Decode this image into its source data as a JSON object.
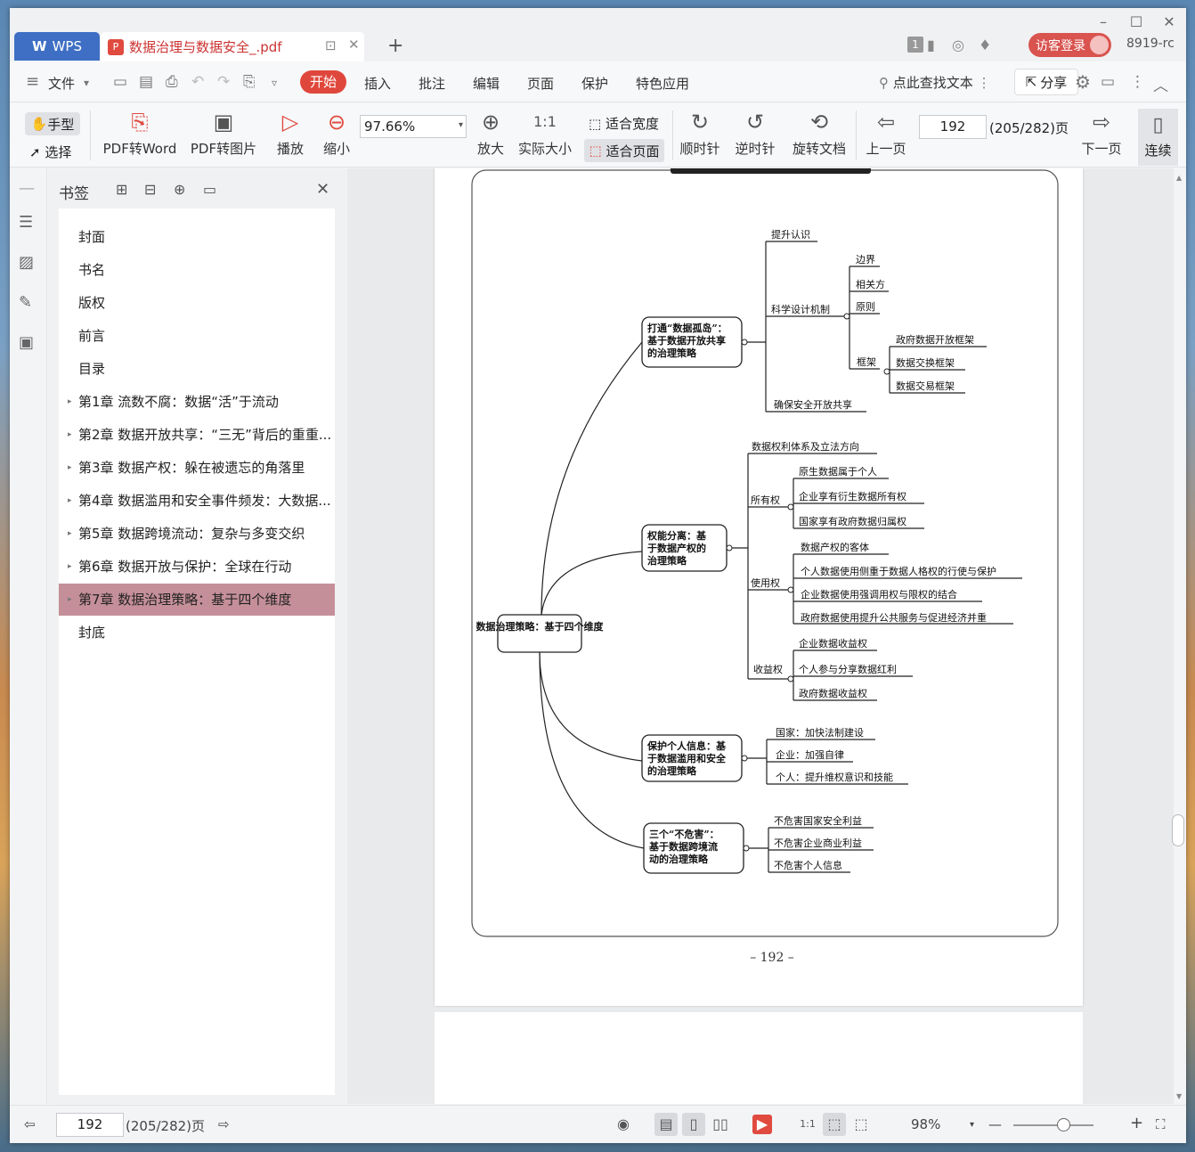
{
  "app": {
    "name": "WPS",
    "tab_title": "数据治理与数据安全_.pdf",
    "user_id": "8919-rc",
    "login_label": "访客登录",
    "badge": "1"
  },
  "menu": {
    "file": "文件",
    "items": [
      "开始",
      "插入",
      "批注",
      "编辑",
      "页面",
      "保护",
      "特色应用"
    ],
    "find": "点此查找文本",
    "share": "分享"
  },
  "toolbar": {
    "hand": "手型",
    "select": "选择",
    "pdf2word": "PDF转Word",
    "pdf2img": "PDF转图片",
    "play": "播放",
    "zoom_out": "缩小",
    "zoom_value": "97.66%",
    "zoom_in": "放大",
    "actual": "实际大小",
    "fit_width": "适合宽度",
    "fit_page": "适合页面",
    "cw": "顺时针",
    "ccw": "逆时针",
    "rotate": "旋转文档",
    "prev": "上一页",
    "page": "192",
    "page_total": "(205/282)页",
    "next": "下一页",
    "continuous": "连续"
  },
  "bookmarks": {
    "title": "书签",
    "items": [
      {
        "label": "封面",
        "arrow": ""
      },
      {
        "label": "书名",
        "arrow": ""
      },
      {
        "label": "版权",
        "arrow": ""
      },
      {
        "label": "前言",
        "arrow": ""
      },
      {
        "label": "目录",
        "arrow": ""
      },
      {
        "label": "第1章 流数不腐：数据“活”于流动",
        "arrow": "▸"
      },
      {
        "label": "第2章 数据开放共享：“三无”背后的重重...",
        "arrow": "▸"
      },
      {
        "label": "第3章 数据产权：躲在被遗忘的角落里",
        "arrow": "▸"
      },
      {
        "label": "第4章 数据滥用和安全事件频发：大数据...",
        "arrow": "▸"
      },
      {
        "label": "第5章 数据跨境流动：复杂与多变交织",
        "arrow": "▸"
      },
      {
        "label": "第6章 数据开放与保护：全球在行动",
        "arrow": "▸"
      },
      {
        "label": "第7章 数据治理策略：基于四个维度",
        "arrow": "▸"
      },
      {
        "label": "封底",
        "arrow": ""
      }
    ],
    "selected_index": 11
  },
  "mindmap": {
    "root": "数据治理策略：基于四个维度",
    "b1": {
      "l1": "打通“数据孤岛”：",
      "l2": "基于数据开放共享",
      "l3": "的治理策略"
    },
    "b1_children": {
      "c1": "提升认识",
      "c2": "科学设计机制",
      "c2a": "边界",
      "c2b": "相关方",
      "c2c": "原则",
      "c2d": "框架",
      "c2d1": "政府数据开放框架",
      "c2d2": "数据交换框架",
      "c2d3": "数据交易框架",
      "c3": "确保安全开放共享"
    },
    "b2": {
      "l1": "权能分离：基",
      "l2": "于数据产权的",
      "l3": "治理策略"
    },
    "b2_children": {
      "c1": "数据权利体系及立法方向",
      "own": "所有权",
      "own1": "原生数据属于个人",
      "own2": "企业享有衍生数据所有权",
      "own3": "国家享有政府数据归属权",
      "use": "使用权",
      "use1": "数据产权的客体",
      "use2": "个人数据使用侧重于数据人格权的行使与保护",
      "use3": "企业数据使用强调用权与限权的结合",
      "use4": "政府数据使用提升公共服务与促进经济并重",
      "inc": "收益权",
      "inc1": "企业数据收益权",
      "inc2": "个人参与分享数据红利",
      "inc3": "政府数据收益权"
    },
    "b3": {
      "l1": "保护个人信息：基",
      "l2": "于数据滥用和安全",
      "l3": "的治理策略"
    },
    "b3_children": {
      "c1": "国家：加快法制建设",
      "c2": "企业：加强自律",
      "c3": "个人：提升维权意识和技能"
    },
    "b4": {
      "l1": "三个“不危害”：",
      "l2": "基于数据跨境流",
      "l3": "动的治理策略"
    },
    "b4_children": {
      "c1": "不危害国家安全利益",
      "c2": "不危害企业商业利益",
      "c3": "不危害个人信息"
    },
    "page_number": "– 192 –"
  },
  "statusbar": {
    "page": "192",
    "page_total": "(205/282)页",
    "zoom": "98%"
  }
}
